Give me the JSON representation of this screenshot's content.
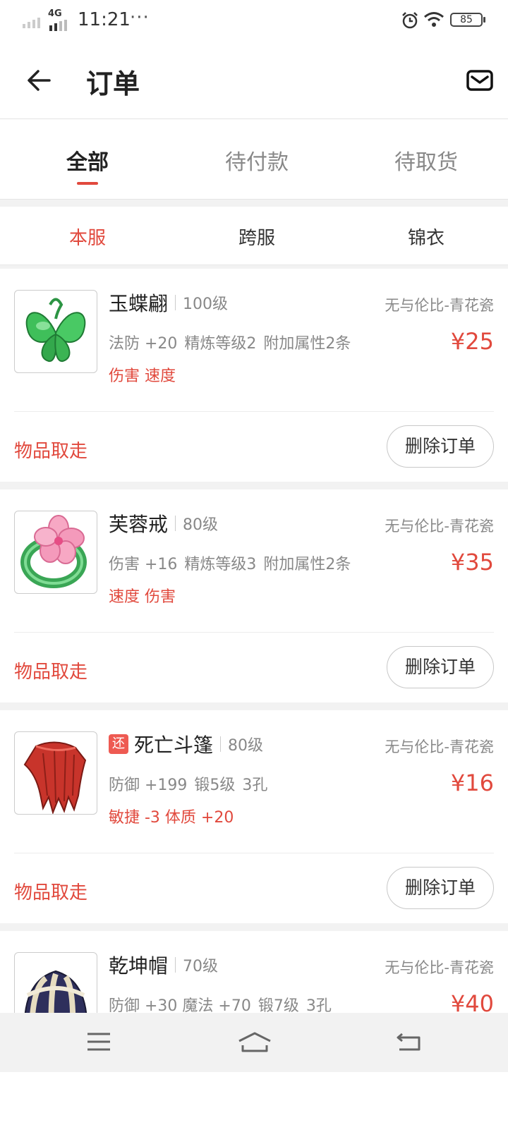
{
  "status_bar": {
    "network": "4G",
    "time": "11:21",
    "dots": "···",
    "battery": "85"
  },
  "header": {
    "title": "订单"
  },
  "tabs": [
    {
      "label": "全部",
      "active": true
    },
    {
      "label": "待付款",
      "active": false
    },
    {
      "label": "待取货",
      "active": false
    }
  ],
  "subtabs": [
    {
      "label": "本服",
      "active": true
    },
    {
      "label": "跨服",
      "active": false
    },
    {
      "label": "锦衣",
      "active": false
    }
  ],
  "orders": [
    {
      "name": "玉蝶翩",
      "level": "100级",
      "server": "无与伦比-青花瓷",
      "attrs": [
        "法防 +20",
        "精炼等级2",
        "附加属性2条"
      ],
      "special": "伤害 速度",
      "price": "¥25",
      "status": "物品取走",
      "action": "删除订单",
      "icon": "jade-butterfly-icon"
    },
    {
      "name": "芙蓉戒",
      "level": "80级",
      "server": "无与伦比-青花瓷",
      "attrs": [
        "伤害 +16",
        "精炼等级3",
        "附加属性2条"
      ],
      "special": "速度 伤害",
      "price": "¥35",
      "status": "物品取走",
      "action": "删除订单",
      "icon": "flower-ring-icon"
    },
    {
      "name": "死亡斗篷",
      "badge": "还",
      "level": "80级",
      "server": "无与伦比-青花瓷",
      "attrs": [
        "防御 +199",
        "锻5级",
        "3孔"
      ],
      "special": "敏捷 -3 体质 +20",
      "price": "¥16",
      "status": "物品取走",
      "action": "删除订单",
      "icon": "red-cloak-icon"
    },
    {
      "name": "乾坤帽",
      "level": "70级",
      "server": "无与伦比-青花瓷",
      "attrs": [
        "防御 +30 魔法 +70",
        "锻7级",
        "3孔"
      ],
      "special": "",
      "price": "¥40",
      "status": "",
      "action": "",
      "icon": "striped-hat-icon"
    }
  ],
  "colors": {
    "accent": "#e1493d",
    "muted": "#888888",
    "text": "#222222"
  }
}
